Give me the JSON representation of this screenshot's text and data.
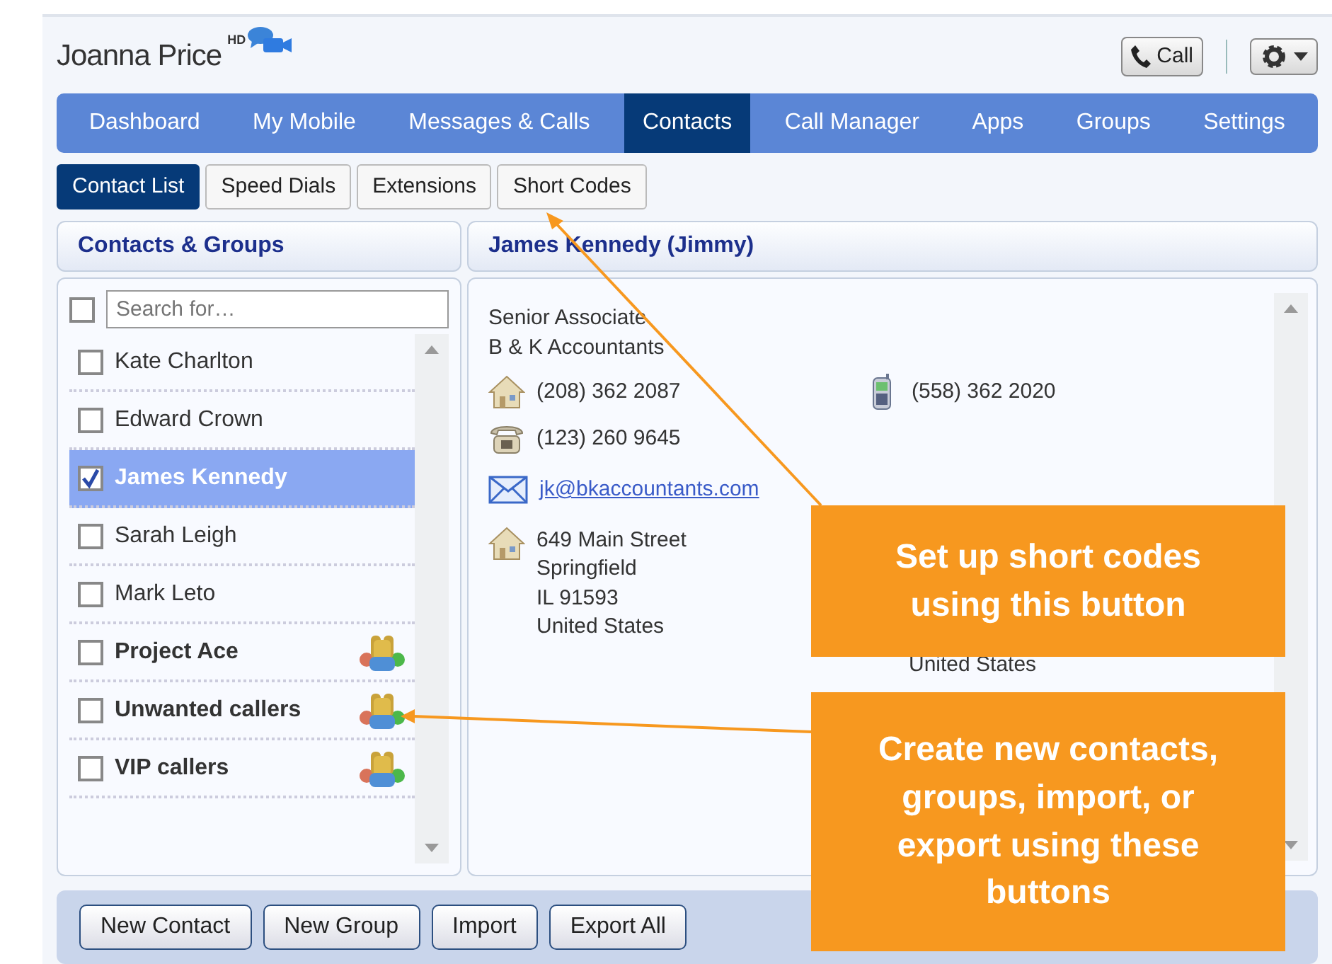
{
  "header": {
    "user_name": "Joanna Price",
    "hd_badge": "HD",
    "call_button": "Call"
  },
  "nav": [
    {
      "label": "Dashboard",
      "selected": false
    },
    {
      "label": "My Mobile",
      "selected": false
    },
    {
      "label": "Messages & Calls",
      "selected": false
    },
    {
      "label": "Contacts",
      "selected": true
    },
    {
      "label": "Call Manager",
      "selected": false
    },
    {
      "label": "Apps",
      "selected": false
    },
    {
      "label": "Groups",
      "selected": false
    },
    {
      "label": "Settings",
      "selected": false
    }
  ],
  "subtabs": [
    {
      "label": "Contact List",
      "selected": true
    },
    {
      "label": "Speed Dials",
      "selected": false
    },
    {
      "label": "Extensions",
      "selected": false
    },
    {
      "label": "Short Codes",
      "selected": false
    }
  ],
  "contacts_panel": {
    "title": "Contacts & Groups",
    "select_all_checked": false,
    "search": {
      "placeholder": "Search for…"
    },
    "items": [
      {
        "name": "Kate Charlton",
        "kind": "contact",
        "checked": false,
        "selected": false
      },
      {
        "name": "Edward Crown",
        "kind": "contact",
        "checked": false,
        "selected": false
      },
      {
        "name": "James Kennedy",
        "kind": "contact",
        "checked": true,
        "selected": true
      },
      {
        "name": "Sarah Leigh",
        "kind": "contact",
        "checked": false,
        "selected": false
      },
      {
        "name": "Mark Leto",
        "kind": "contact",
        "checked": false,
        "selected": false
      },
      {
        "name": "Project Ace",
        "kind": "group",
        "checked": false,
        "selected": false
      },
      {
        "name": "Unwanted callers",
        "kind": "group",
        "checked": false,
        "selected": false
      },
      {
        "name": "VIP callers",
        "kind": "group",
        "checked": false,
        "selected": false
      }
    ]
  },
  "detail_panel": {
    "title": "James Kennedy (Jimmy)",
    "job_title": "Senior Associate",
    "company": "B & K Accountants",
    "phones": [
      {
        "kind": "home",
        "number": "(208) 362 2087"
      },
      {
        "kind": "mobile",
        "number": "(558) 362 2020"
      },
      {
        "kind": "landline",
        "number": "(123) 260 9645"
      }
    ],
    "email": "jk@bkaccountants.com",
    "addresses": [
      {
        "lines": [
          "649 Main Street",
          "Springfield",
          "IL 91593",
          "United States"
        ]
      },
      {
        "lines": [
          "United States"
        ]
      }
    ]
  },
  "buttons": [
    "New Contact",
    "New Group",
    "Import",
    "Export All"
  ],
  "callouts": [
    {
      "text": "Set up short codes using this button"
    },
    {
      "text": "Create new contacts, groups, import, or export using these buttons"
    }
  ]
}
